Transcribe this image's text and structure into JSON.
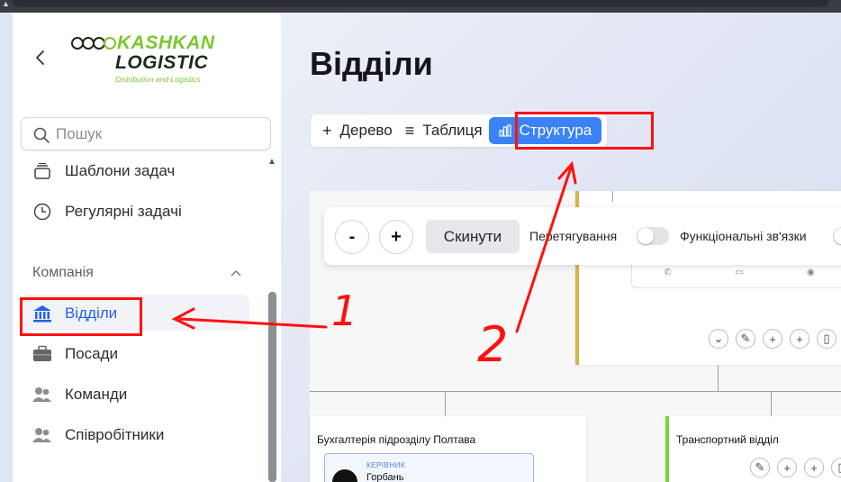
{
  "sidebar": {
    "logo": {
      "line1": "KASHKAN",
      "line2": "LOGISTIC",
      "tagline": "Distribution and Logistics"
    },
    "search": {
      "placeholder": "Пошук"
    },
    "items_top": [
      {
        "label": "Шаблони задач",
        "icon": "template-stack-icon"
      },
      {
        "label": "Регулярні задачі",
        "icon": "clock-icon"
      }
    ],
    "section": {
      "label": "Компанія"
    },
    "items_company": [
      {
        "label": "Відділи",
        "icon": "bank-building-icon",
        "active": true
      },
      {
        "label": "Посади",
        "icon": "briefcase-icon"
      },
      {
        "label": "Команди",
        "icon": "users-icon"
      },
      {
        "label": "Співробітники",
        "icon": "users-icon"
      }
    ],
    "accent": "#2563eb"
  },
  "main": {
    "title": "Відділи",
    "tabs": [
      {
        "label": "Дерево",
        "icon": "+"
      },
      {
        "label": "Таблиця",
        "icon": "≡"
      },
      {
        "label": "Структура",
        "icon": "bar-chart-icon",
        "active": true
      }
    ],
    "toolbar": {
      "zoom_out": "-",
      "zoom_in": "+",
      "reset": "Скинути",
      "drag_label": "Перетягування",
      "links_label": "Функціональні зв'язки"
    },
    "nodes": [
      {
        "name": "Бухгалтерія підрозділу Полтава",
        "lead_role": "КЕРІВНИК",
        "lead_name": "Горбань"
      },
      {
        "name": "Транспортний відділ"
      }
    ]
  },
  "annotations": {
    "mark1": "1",
    "mark2": "2",
    "color": "#ff1010"
  }
}
